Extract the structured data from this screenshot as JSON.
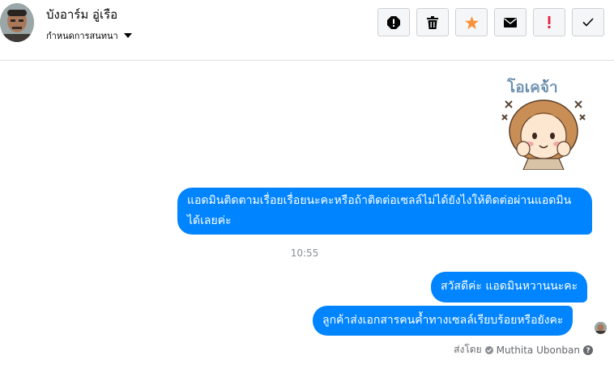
{
  "header": {
    "contact_name": "บังอาร์ม อู่เรือ",
    "assign_label": "กำหนดการสนทนา",
    "toolbar": [
      {
        "name": "spam-report-icon",
        "color": "#050505"
      },
      {
        "name": "trash-icon",
        "color": "#050505"
      },
      {
        "name": "star-icon",
        "color": "#f7923a"
      },
      {
        "name": "envelope-icon",
        "color": "#050505"
      },
      {
        "name": "exclamation-icon",
        "color": "#e41e3f"
      },
      {
        "name": "checkmark-icon",
        "color": "#050505"
      }
    ]
  },
  "messages": {
    "sticker_text": "โอเคจ้า",
    "bubble1": "แอดมินติดตามเรื่อยเรื่อยนะคะหรือถ้าติดต่อเซลล์ไม่ได้ยังไงให้ติดต่อผ่านแอดมินได้เลยค่ะ",
    "timestamp": "10:55",
    "bubble2": "สวัสดีค่ะ แอดมินหวานนะคะ",
    "bubble3": "ลูกค้าส่งเอกสารคนค้ำทางเซลล์เรียบร้อยหรือยังคะ"
  },
  "footer": {
    "sent_by_label": "ส่งโดย",
    "sender_name": "Muthita Ubonban"
  },
  "colors": {
    "bubble": "#0084ff",
    "border": "#ced0d4"
  }
}
